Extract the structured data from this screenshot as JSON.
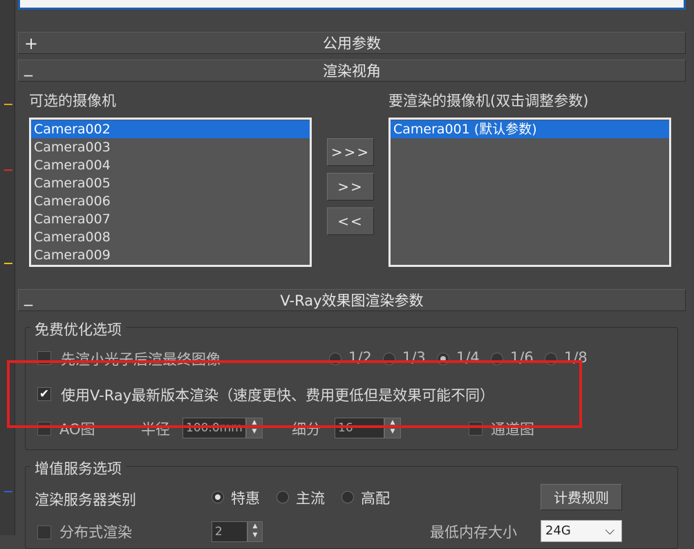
{
  "sections": {
    "common": {
      "toggle": "+",
      "title": "公用参数"
    },
    "render_view": {
      "toggle": "_",
      "title": "渲染视角"
    },
    "vray": {
      "toggle": "_",
      "title": "V-Ray效果图渲染参数"
    }
  },
  "cameras": {
    "available_label": "可选的摄像机",
    "selected_label": "要渲染的摄像机(双击调整参数)",
    "available": [
      "Camera002",
      "Camera003",
      "Camera004",
      "Camera005",
      "Camera006",
      "Camera007",
      "Camera008",
      "Camera009"
    ],
    "available_selected_index": 0,
    "selected": [
      "Camera001 (默认参数)"
    ],
    "move_all_label": ">>>",
    "move_one_label": ">>",
    "move_back_label": "<<"
  },
  "free_options": {
    "title": "免费优化选项",
    "light_first_label": "先渲小光子后渲最终图像",
    "light_first_checked": false,
    "ratios": [
      "1/2",
      "1/3",
      "1/4",
      "1/6",
      "1/8"
    ],
    "ratio_selected": "1/4",
    "latest_vray_label": "使用V-Ray最新版本渲染（速度更快、费用更低但是效果可能不同）",
    "latest_vray_checked": true,
    "ao_label": "AO图",
    "ao_checked": false,
    "radius_label": "半径",
    "radius_value": "100.0mm",
    "subdiv_label": "细分",
    "subdiv_value": "16",
    "channel_label": "通道图",
    "channel_checked": false
  },
  "value_added": {
    "title": "增值服务选项",
    "server_type_label": "渲染服务器类别",
    "server_types": [
      "特惠",
      "主流",
      "高配"
    ],
    "server_type_selected": "特惠",
    "billing_rules_label": "计费规则",
    "distributed_label": "分布式渲染",
    "distributed_checked": false,
    "distributed_value": "2",
    "min_memory_label": "最低内存大小",
    "min_memory_value": "24G"
  },
  "colors": {
    "background": "#444444",
    "selection": "#1e6fd6",
    "highlight": "#e02020"
  }
}
